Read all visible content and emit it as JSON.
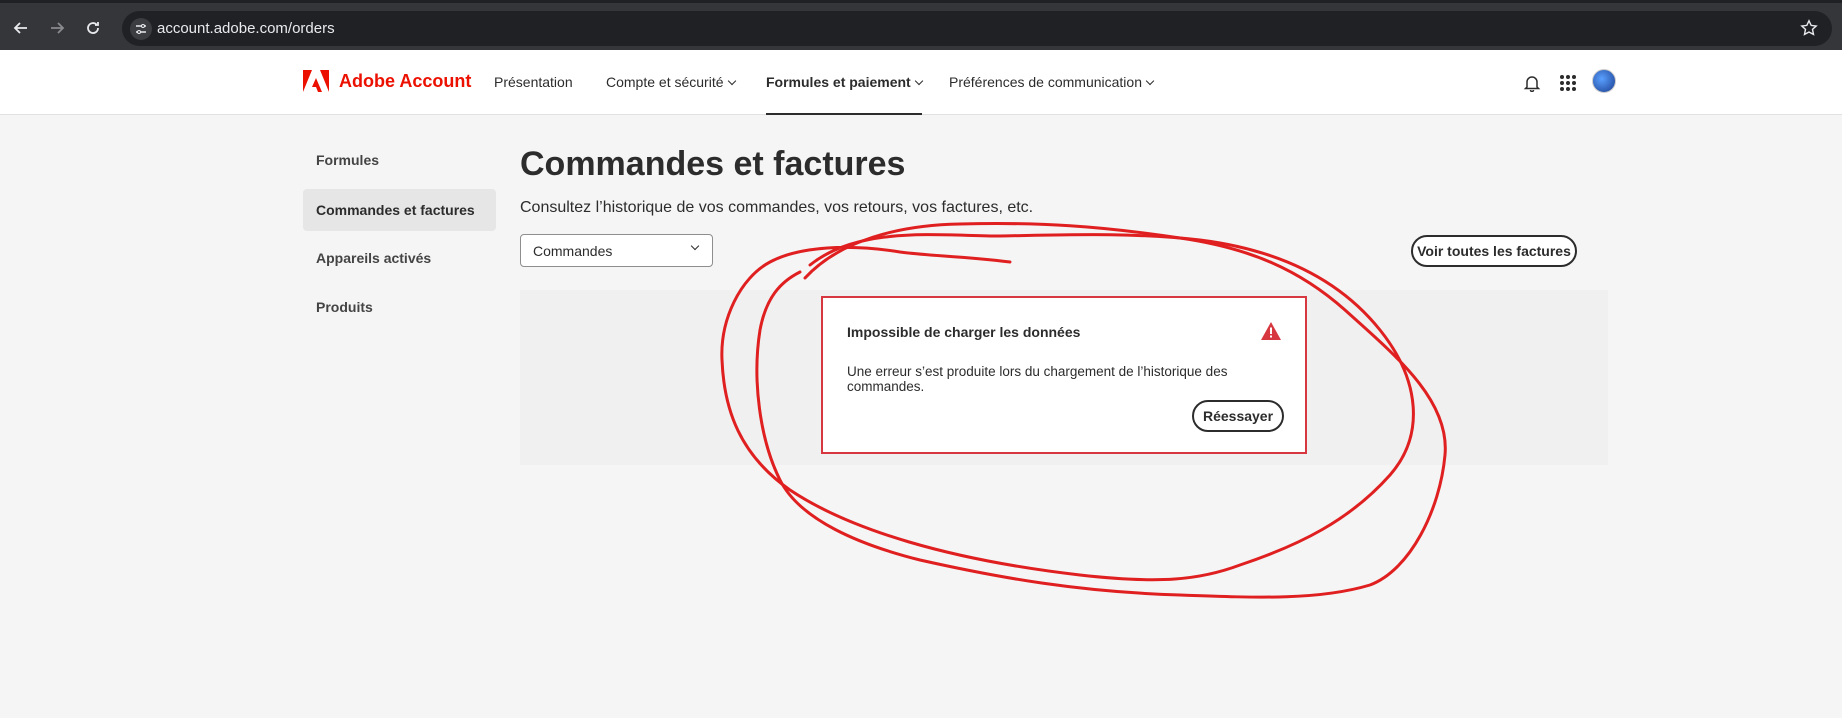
{
  "browser": {
    "url": "account.adobe.com/orders"
  },
  "header": {
    "logo_text": "Adobe Account",
    "nav": [
      {
        "label": "Présentation"
      },
      {
        "label": "Compte et sécurité"
      },
      {
        "label": "Formules et paiement"
      },
      {
        "label": "Préférences de communication"
      }
    ]
  },
  "sidebar": {
    "items": [
      {
        "label": "Formules"
      },
      {
        "label": "Commandes et factures"
      },
      {
        "label": "Appareils activés"
      },
      {
        "label": "Produits"
      }
    ]
  },
  "main": {
    "title": "Commandes et factures",
    "subtitle": "Consultez l’historique de vos commandes, vos retours, vos factures, etc.",
    "select_value": "Commandes",
    "view_invoices_label": "Voir toutes les factures"
  },
  "error": {
    "title": "Impossible de charger les données",
    "message": "Une erreur s’est produite lors du chargement de l’historique des commandes.",
    "retry_label": "Réessayer"
  },
  "colors": {
    "brand": "#eb1000",
    "error": "#d7373f",
    "annotation": "#e02020"
  },
  "icons": [
    "back-arrow-icon",
    "forward-arrow-icon",
    "reload-icon",
    "site-settings-icon",
    "star-icon",
    "adobe-logo-icon",
    "bell-icon",
    "apps-grid-icon",
    "avatar",
    "chevron-down-icon",
    "alert-triangle-icon"
  ]
}
